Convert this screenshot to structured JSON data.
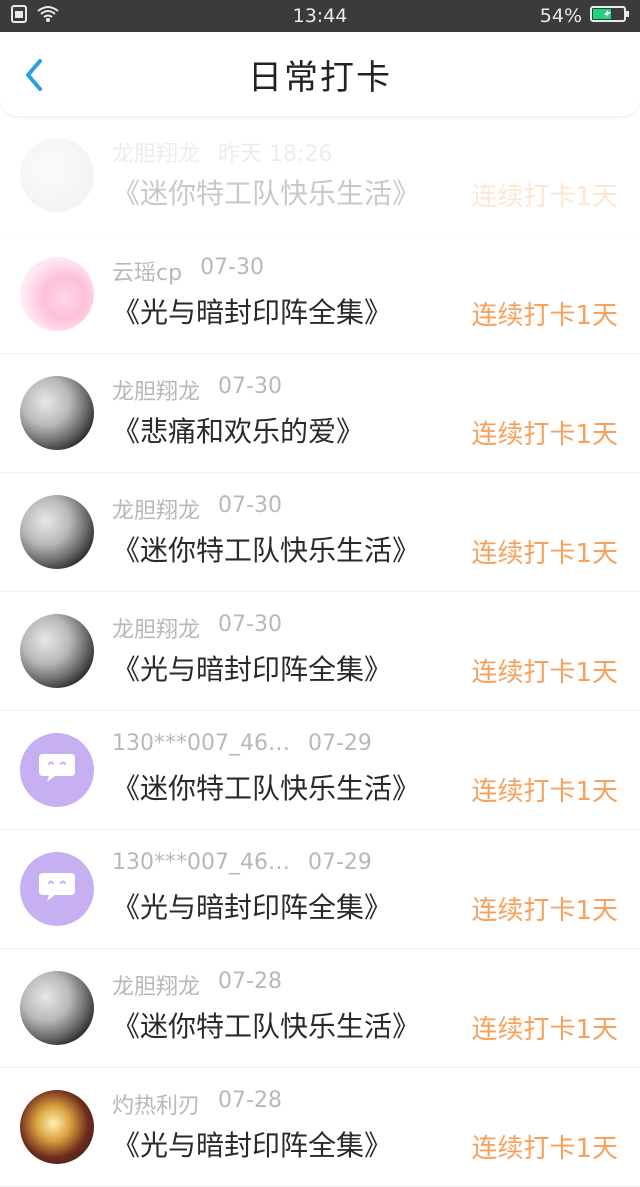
{
  "status_bar": {
    "time": "13:44",
    "battery": "54%",
    "left_icons": [
      "sim-icon",
      "wifi-icon"
    ],
    "right_icons": [
      "battery-icon"
    ]
  },
  "header": {
    "back_icon": "chevron-left-icon",
    "title": "日常打卡"
  },
  "colors": {
    "accent_blue": "#27a0e6",
    "streak_orange": "#f7a15c",
    "secondary_text": "#b8b8b8"
  },
  "items": [
    {
      "user": "龙胆翔龙",
      "date": "昨天 18:26",
      "book": "《迷你特工队快乐生活》",
      "streak": "连续打卡1天"
    },
    {
      "user": "云瑶cp",
      "date": "07-30",
      "book": "《光与暗封印阵全集》",
      "streak": "连续打卡1天"
    },
    {
      "user": "龙胆翔龙",
      "date": "07-30",
      "book": "《悲痛和欢乐的爱》",
      "streak": "连续打卡1天"
    },
    {
      "user": "龙胆翔龙",
      "date": "07-30",
      "book": "《迷你特工队快乐生活》",
      "streak": "连续打卡1天"
    },
    {
      "user": "龙胆翔龙",
      "date": "07-30",
      "book": "《光与暗封印阵全集》",
      "streak": "连续打卡1天"
    },
    {
      "user": "130***007_46…",
      "date": "07-29",
      "book": "《迷你特工队快乐生活》",
      "streak": "连续打卡1天"
    },
    {
      "user": "130***007_46…",
      "date": "07-29",
      "book": "《光与暗封印阵全集》",
      "streak": "连续打卡1天"
    },
    {
      "user": "龙胆翔龙",
      "date": "07-28",
      "book": "《迷你特工队快乐生活》",
      "streak": "连续打卡1天"
    },
    {
      "user": "灼热利刃",
      "date": "07-28",
      "book": "《光与暗封印阵全集》",
      "streak": "连续打卡1天"
    }
  ]
}
